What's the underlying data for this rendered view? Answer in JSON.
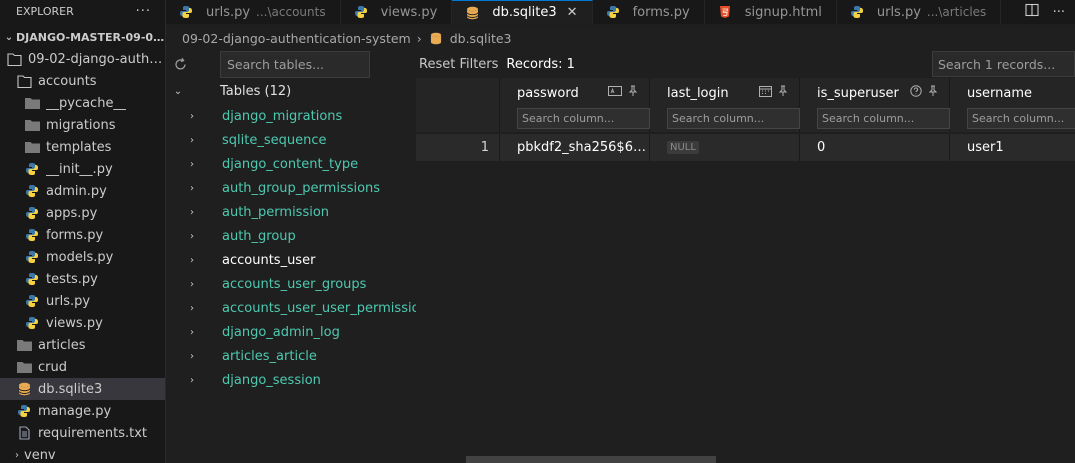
{
  "explorer": {
    "title": "EXPLORER",
    "root": "DJANGO-MASTER-09-02-...",
    "project": "09-02-django-authen...",
    "folder": "accounts",
    "accounts_children": [
      "__pycache__",
      "migrations",
      "templates",
      "__init__.py",
      "admin.py",
      "apps.py",
      "forms.py",
      "models.py",
      "tests.py",
      "urls.py",
      "views.py"
    ],
    "siblings": {
      "articles": "articles",
      "crud": "crud",
      "db": "db.sqlite3",
      "manage": "manage.py",
      "requirements": "requirements.txt",
      "venv": "venv"
    }
  },
  "tabs": [
    {
      "label": "urls.py",
      "desc": "...\\accounts"
    },
    {
      "label": "views.py",
      "desc": ""
    },
    {
      "label": "db.sqlite3",
      "desc": ""
    },
    {
      "label": "forms.py",
      "desc": ""
    },
    {
      "label": "signup.html",
      "desc": ""
    },
    {
      "label": "urls.py",
      "desc": "...\\articles"
    }
  ],
  "breadcrumb": {
    "folder": "09-02-django-authentication-system",
    "file": "db.sqlite3"
  },
  "db_viewer": {
    "search_tables_placeholder": "Search tables...",
    "tables_heading": "Tables (12)",
    "tables": [
      "django_migrations",
      "sqlite_sequence",
      "django_content_type",
      "auth_group_permissions",
      "auth_permission",
      "auth_group",
      "accounts_user",
      "accounts_user_groups",
      "accounts_user_user_permissions",
      "django_admin_log",
      "articles_article",
      "django_session"
    ],
    "reset_label": "Reset Filters",
    "records_label": "Records: 1",
    "search_records_placeholder": "Search 1 records...",
    "column_search_placeholder": "Search column...",
    "columns": [
      "password",
      "last_login",
      "is_superuser",
      "username"
    ],
    "rows": [
      {
        "num": "1",
        "password": "pbkdf2_sha256$6000...",
        "last_login": "NULL",
        "is_superuser": "0",
        "username": "user1"
      }
    ]
  },
  "colors": {
    "accent": "#0078d4",
    "table_name": "#4ec9b0",
    "folder": "#c5c5c5",
    "python_blue": "#3b77a8",
    "python_yellow": "#f5d240",
    "db_icon": "#e8ab53",
    "html_icon": "#e44d26"
  }
}
